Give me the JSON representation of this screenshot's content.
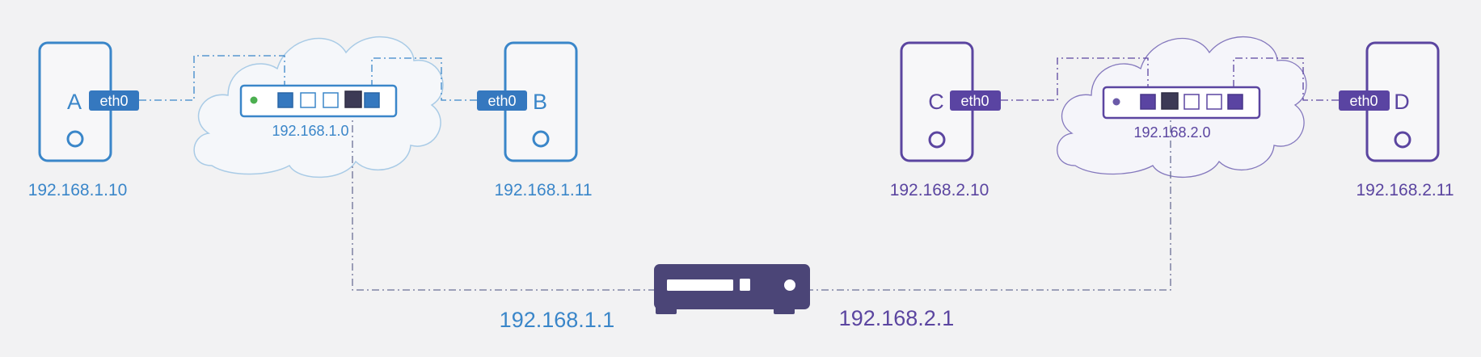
{
  "colors": {
    "background": "#f2f2f3",
    "network1": "#3a86c9",
    "network1_fill": "#3578bf",
    "network2": "#5b45a0",
    "network2_fill": "#5a44a2",
    "router": "#4b4577",
    "port_dark": "#3c3a55",
    "cloud1": "#a9cbe6",
    "cloud2": "#8478bd",
    "led1": "#4caf50",
    "led2": "#6a5aa8"
  },
  "network1": {
    "host_a": {
      "letter": "A",
      "interface": "eth0",
      "ip": "192.168.1.10"
    },
    "host_b": {
      "letter": "B",
      "interface": "eth0",
      "ip": "192.168.1.11"
    },
    "switch_label": "192.168.1.0",
    "gateway_ip": "192.168.1.1"
  },
  "network2": {
    "host_c": {
      "letter": "C",
      "interface": "eth0",
      "ip": "192.168.2.10"
    },
    "host_d": {
      "letter": "D",
      "interface": "eth0",
      "ip": "192.168.2.11"
    },
    "switch_label": "192.168.2.0",
    "gateway_ip": "192.168.2.1"
  },
  "icons": {
    "host": "server-icon",
    "switch": "switch-icon",
    "cloud": "cloud-icon",
    "router": "router-icon"
  }
}
